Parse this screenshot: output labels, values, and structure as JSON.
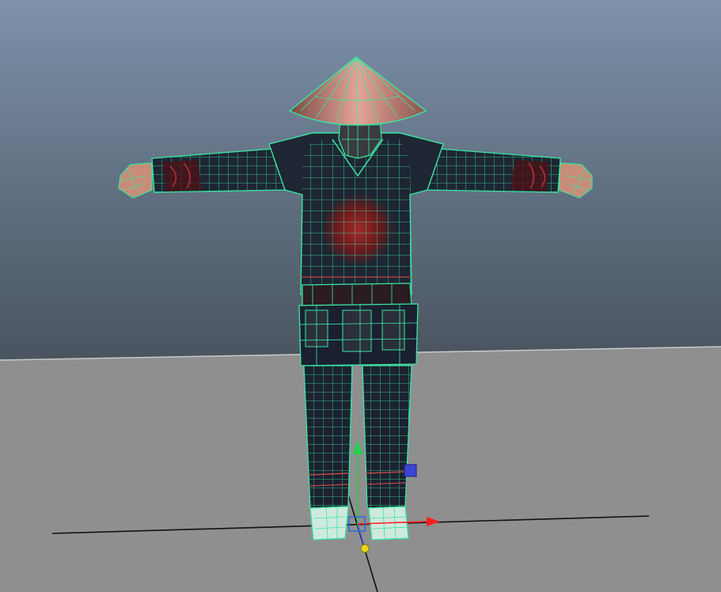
{
  "viewport": {
    "name": "perspective-viewport",
    "colors": {
      "sky_top": "#7e92ab",
      "sky_bottom": "#3c434a",
      "ground": "#8f8f8f",
      "wireframe": "#39e6a0",
      "cloth": "#1e2633",
      "cloth_shadow": "#151b25",
      "emblem": "#8a2424",
      "skin": "#c98c78",
      "hat": "#c07b6f"
    }
  },
  "model": {
    "name": "straw-hat-warrior-mesh",
    "pose": "T-pose",
    "selected": true
  },
  "manipulator": {
    "type": "move-tool",
    "axes": [
      {
        "axis": "x",
        "color": "#ff1f1f"
      },
      {
        "axis": "y",
        "color": "#22d04a"
      },
      {
        "axis": "z",
        "color": "#3b46d6"
      }
    ],
    "center_color": "#2b6dd8",
    "pivot_color": "#e8d61e"
  }
}
